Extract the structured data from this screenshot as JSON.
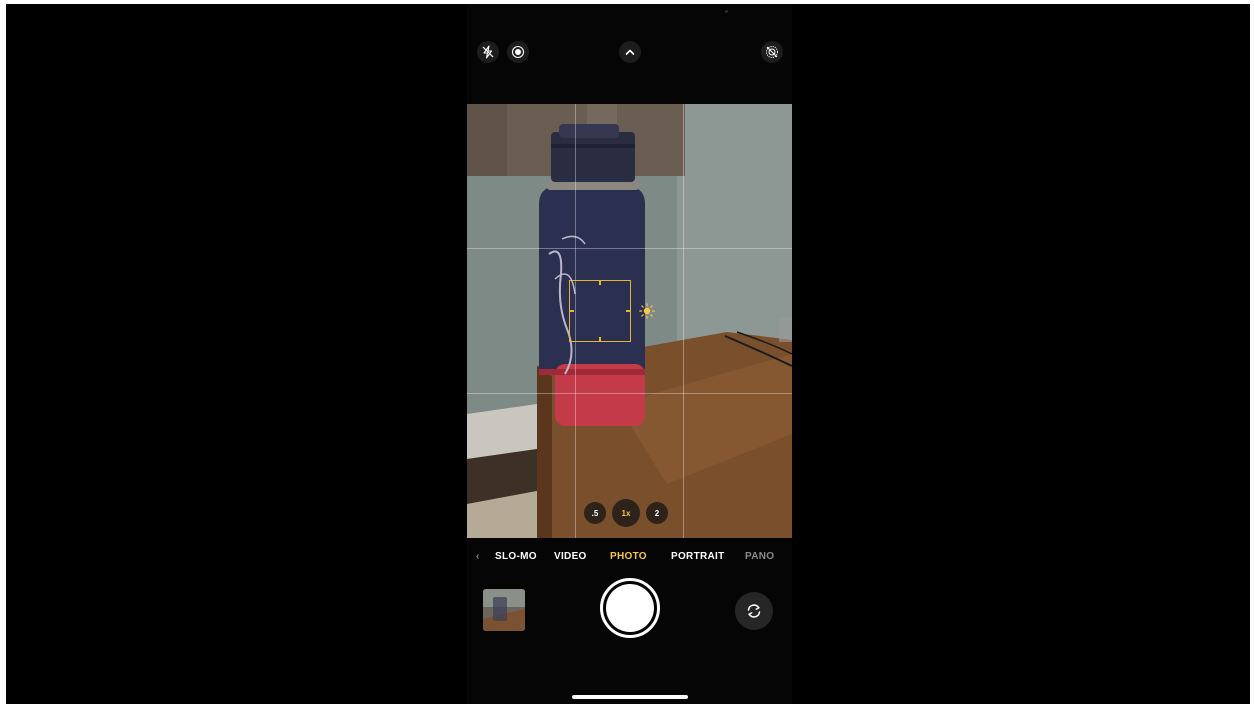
{
  "camera": {
    "modes": {
      "slomo": "SLO-MO",
      "video": "VIDEO",
      "photo": "PHOTO",
      "portrait": "PORTRAIT",
      "pano": "PANO",
      "selected": "PHOTO"
    },
    "zoom": {
      "wide": ".5",
      "main": "1x",
      "tele": "2",
      "selected": "1x"
    },
    "top_bar_icons": [
      "flash-off-icon",
      "live-photo-icon",
      "chevron-up-icon",
      "live-off-icon"
    ],
    "accent_color": "#f7c64a",
    "focus_color": "#e6b33a",
    "grid": true
  }
}
